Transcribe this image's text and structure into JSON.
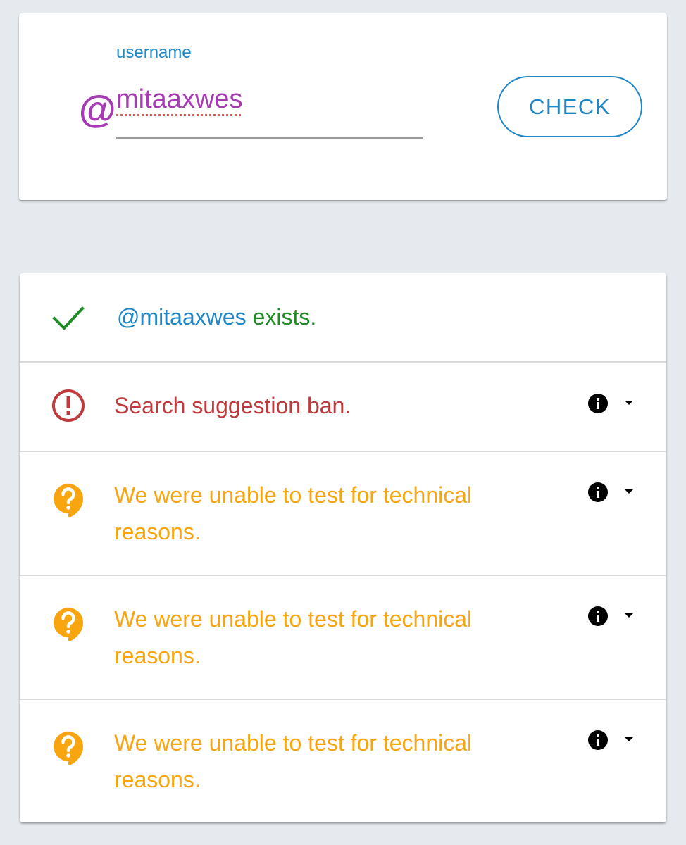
{
  "input": {
    "label": "username",
    "value": "mitaaxwes",
    "at_symbol": "@",
    "at_icon": "at-sign-icon",
    "button_label": "CHECK"
  },
  "results": [
    {
      "status": "ok",
      "icon": "check-icon",
      "handle": "@mitaaxwes",
      "text": "exists."
    },
    {
      "status": "banned",
      "icon": "alert-circle-icon",
      "text": "Search suggestion ban.",
      "action_icons": [
        "info-icon",
        "dropdown-caret-icon"
      ]
    },
    {
      "status": "unknown",
      "icon": "question-bubble-icon",
      "text": "We were unable to test for technical reasons.",
      "action_icons": [
        "info-icon",
        "dropdown-caret-icon"
      ]
    },
    {
      "status": "unknown",
      "icon": "question-bubble-icon",
      "text": "We were unable to test for technical reasons.",
      "action_icons": [
        "info-icon",
        "dropdown-caret-icon"
      ]
    },
    {
      "status": "unknown",
      "icon": "question-bubble-icon",
      "text": "We were unable to test for technical reasons.",
      "action_icons": [
        "info-icon",
        "dropdown-caret-icon"
      ]
    }
  ],
  "colors": {
    "background": "#e6eaee",
    "accent_blue": "#1f86c7",
    "handle_purple": "#a63bb3",
    "success_green": "#1e8c24",
    "error_red": "#c0393c",
    "warning_orange": "#f8a50f"
  }
}
